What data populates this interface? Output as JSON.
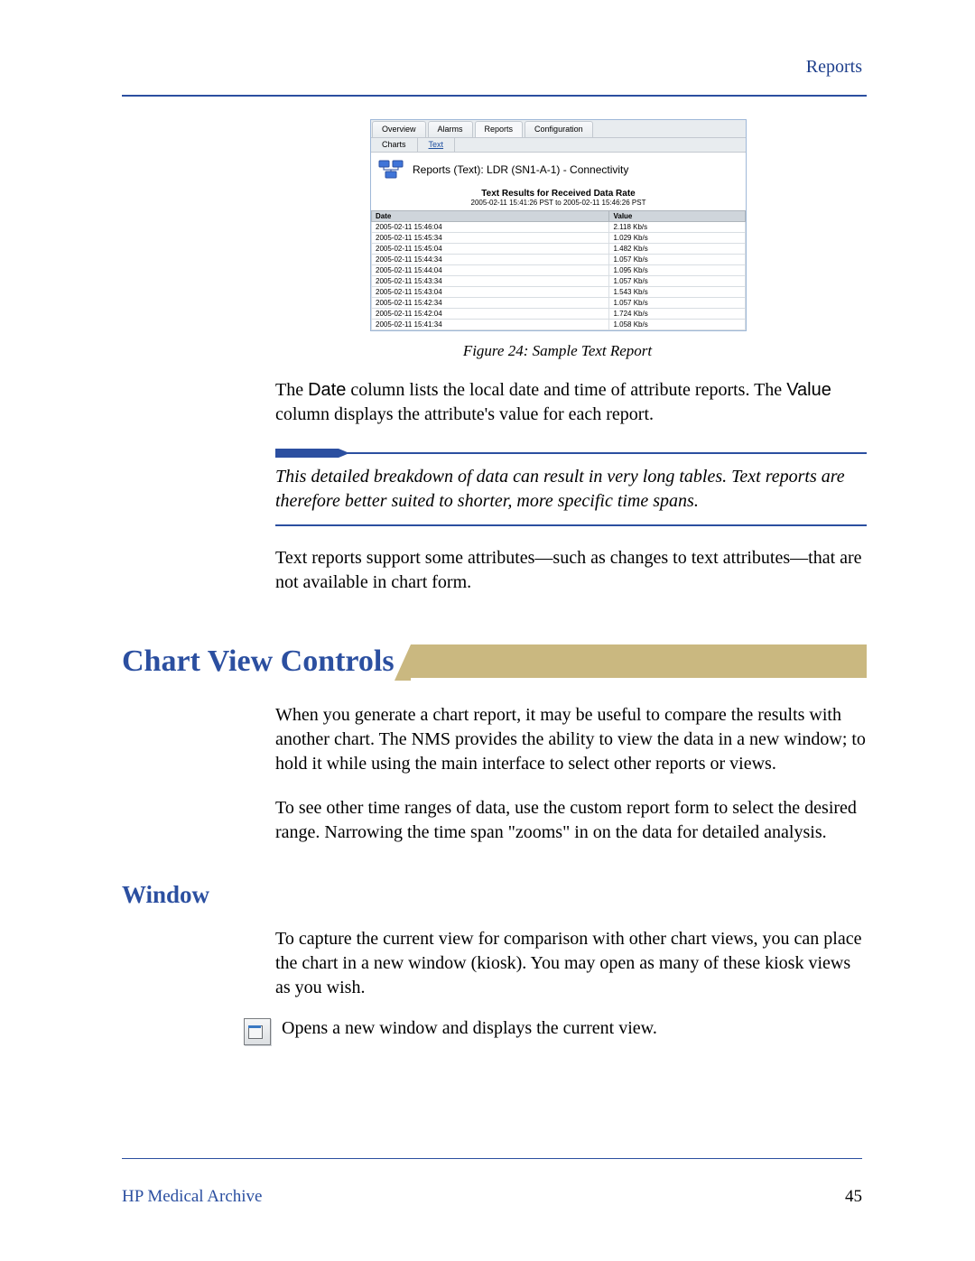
{
  "header": {
    "right_link": "Reports"
  },
  "figure": {
    "tabs": [
      "Overview",
      "Alarms",
      "Reports",
      "Configuration"
    ],
    "subtabs": [
      "Charts",
      "Text"
    ],
    "panel_title": "Reports (Text): LDR (SN1-A-1) - Connectivity",
    "result_title": "Text Results for Received Data Rate",
    "result_range": "2005-02-11 15:41:26 PST to 2005-02-11 15:46:26 PST",
    "columns": [
      "Date",
      "Value"
    ],
    "rows": [
      [
        "2005-02-11 15:46:04",
        "2.118 Kb/s"
      ],
      [
        "2005-02-11 15:45:34",
        "1.029 Kb/s"
      ],
      [
        "2005-02-11 15:45:04",
        "1.482 Kb/s"
      ],
      [
        "2005-02-11 15:44:34",
        "1.057 Kb/s"
      ],
      [
        "2005-02-11 15:44:04",
        "1.095 Kb/s"
      ],
      [
        "2005-02-11 15:43:34",
        "1.057 Kb/s"
      ],
      [
        "2005-02-11 15:43:04",
        "1.543 Kb/s"
      ],
      [
        "2005-02-11 15:42:34",
        "1.057 Kb/s"
      ],
      [
        "2005-02-11 15:42:04",
        "1.724 Kb/s"
      ],
      [
        "2005-02-11 15:41:34",
        "1.058 Kb/s"
      ]
    ],
    "caption": "Figure 24: Sample Text Report"
  },
  "para1_pre": "The ",
  "para1_date": "Date",
  "para1_mid": " column lists the local date and time of attribute reports. The ",
  "para1_value": "Value",
  "para1_post": " column displays the attribute's value for each report.",
  "note": "This detailed breakdown of data can result in very long tables. Text reports are therefore better suited to shorter, more specific time spans.",
  "para2": "Text reports support some attributes—such as changes to text attributes—that are not available in chart form.",
  "section_title": "Chart View Controls",
  "para3": "When you generate a chart report, it may be useful to compare the results with another chart. The NMS provides the ability to view the data in a new window; to hold it while using the main interface to select other reports or views.",
  "para4": "To see other time ranges of data, use the custom report form to select the desired range. Narrowing the time span \"zooms\" in on the data for detailed analysis.",
  "subheading": "Window",
  "para5": "To capture the current view for comparison with other chart views, you can place the chart in a new window (kiosk). You may open as many of these kiosk views as you wish.",
  "para6": "Opens a new window and displays the current view.",
  "footer": {
    "left": "HP Medical Archive",
    "page": "45"
  }
}
